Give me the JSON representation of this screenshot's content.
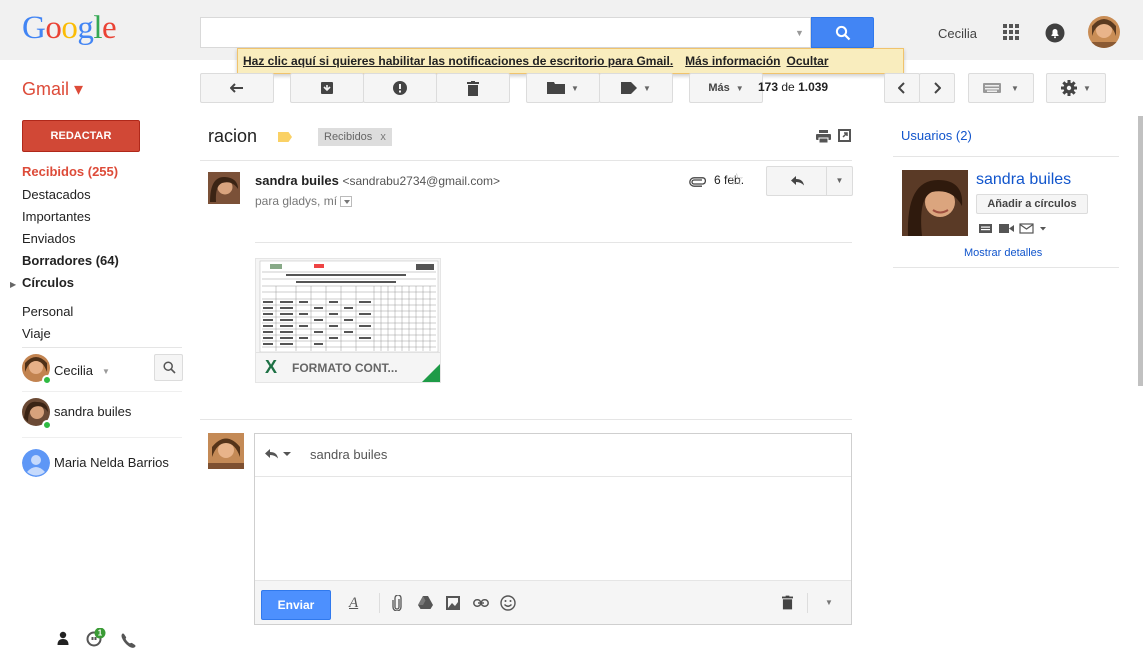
{
  "header": {
    "logo": "Google",
    "user_name": "Cecilia",
    "search_placeholder": ""
  },
  "banner": {
    "text": "Haz clic aquí si quieres habilitar las notificaciones de escritorio para Gmail.",
    "link_more": "Más información",
    "link_hide": "Ocultar"
  },
  "toolbar": {
    "app_label": "Gmail ▾",
    "more_label": "Más",
    "pager_range": "173",
    "pager_of": "de",
    "pager_total": "1.039"
  },
  "nav": {
    "compose": "REDACTAR",
    "items": [
      "Recibidos (255)",
      "Destacados",
      "Importantes",
      "Enviados",
      "Borradores (64)",
      "Círculos",
      "Personal",
      "Viaje"
    ]
  },
  "chat": {
    "self_name": "Cecilia",
    "contacts": [
      "sandra builes",
      "Maria Nelda Barrios"
    ],
    "badge_count": "1"
  },
  "conversation": {
    "subject": "racion",
    "label": "Recibidos",
    "label_close": "x"
  },
  "message": {
    "sender_name": "sandra builes",
    "sender_email": "<sandrabu2734@gmail.com>",
    "to": "para gladys, mí",
    "date": "6 feb.",
    "attachment_name": "FORMATO CONT..."
  },
  "reply": {
    "to": "sandra builes",
    "send_label": "Enviar"
  },
  "people": {
    "title": "Usuarios (2)",
    "name": "sandra builes",
    "add_button": "Añadir a círculos",
    "details_link": "Mostrar detalles"
  },
  "colors": {
    "accent_red": "#dd4b39",
    "compose_red": "#d14836",
    "link_blue": "#1155cc",
    "search_blue": "#4285f4",
    "banner_yellow": "#f9edbe",
    "presence_green": "#2fbb43"
  }
}
